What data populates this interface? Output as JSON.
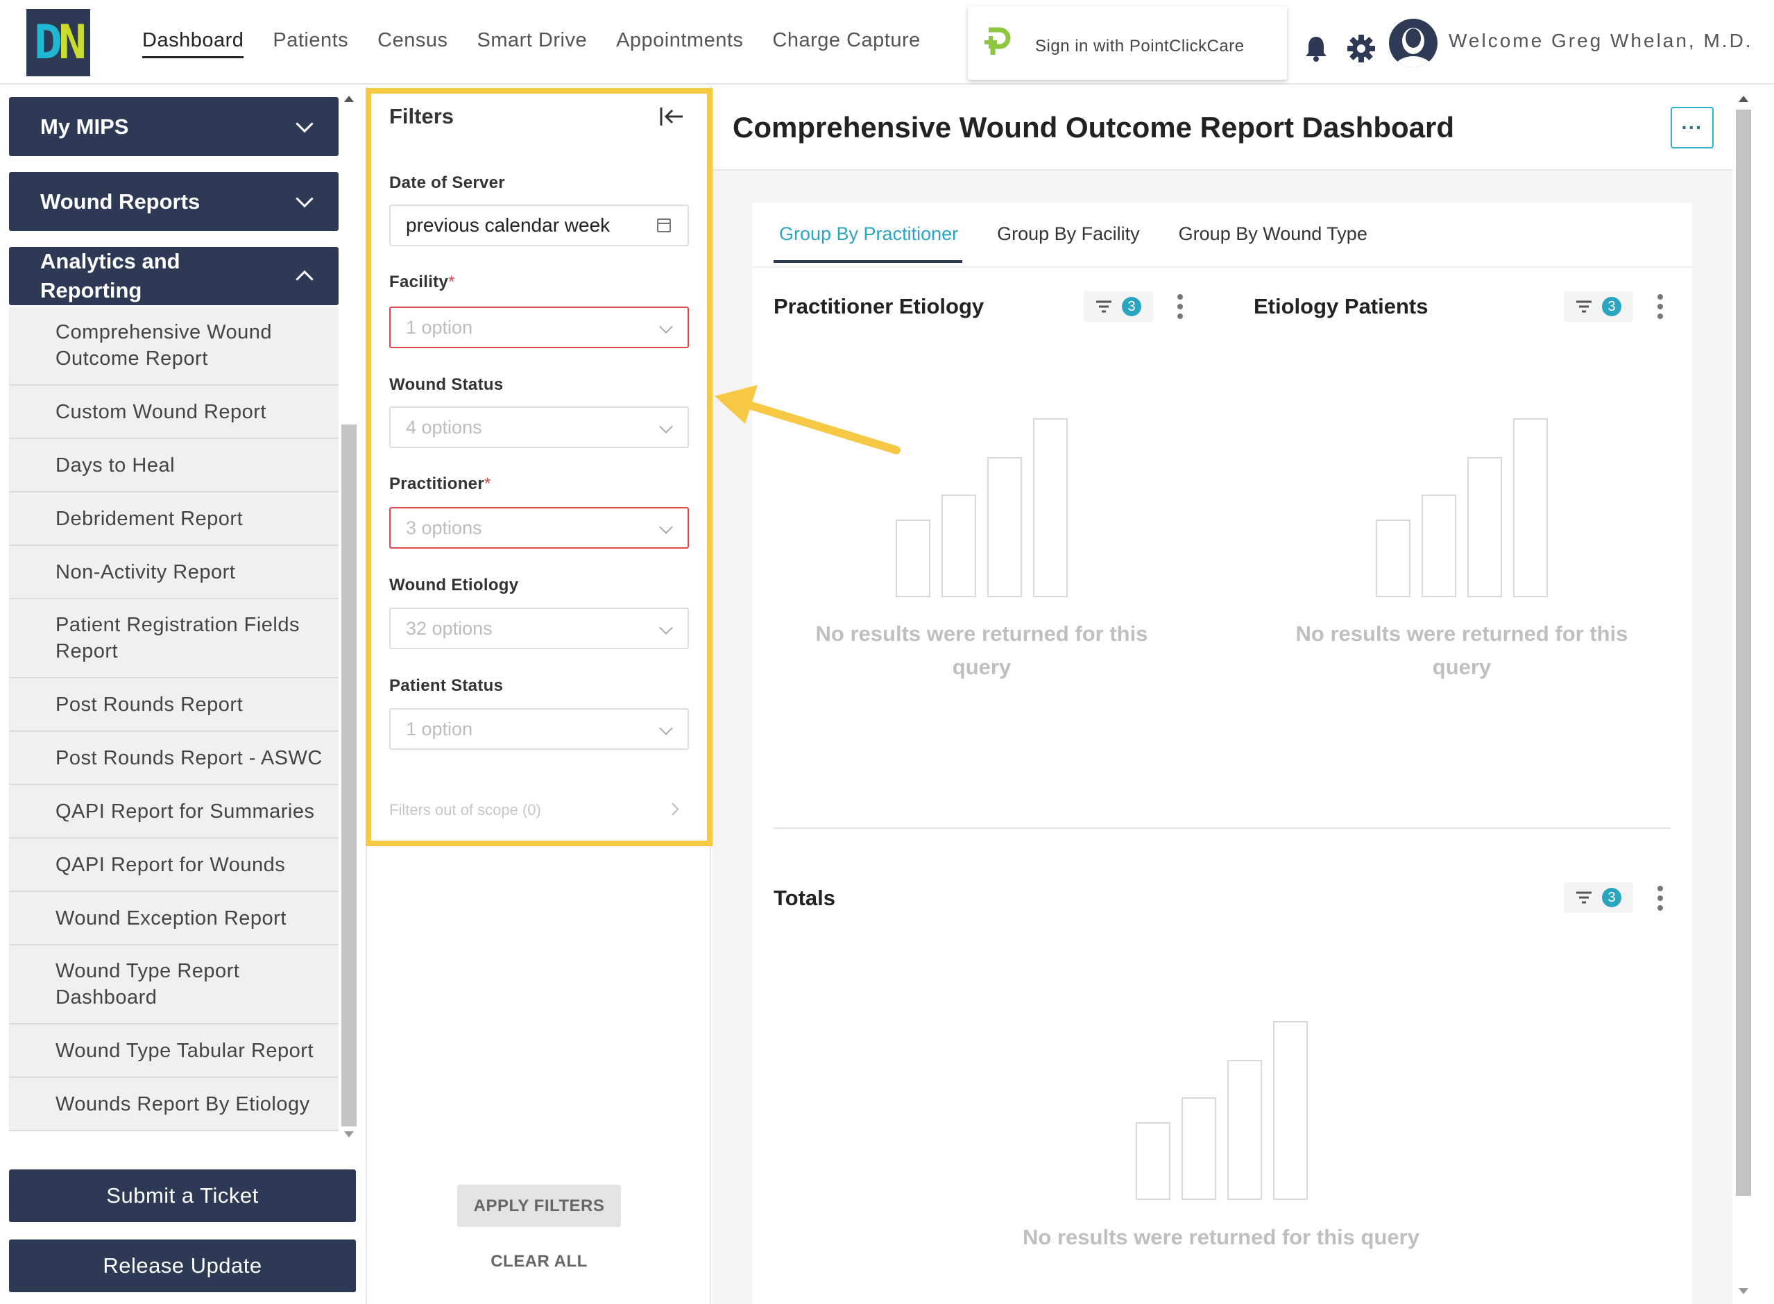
{
  "brand": {
    "logo_d": "D",
    "logo_n": "N"
  },
  "nav": {
    "items": [
      "Dashboard",
      "Patients",
      "Census",
      "Smart Drive",
      "Appointments",
      "Charge Capture"
    ],
    "active": "Dashboard"
  },
  "pcc": {
    "label": "Sign in with PointClickCare"
  },
  "user": {
    "welcome": "Welcome Greg Whelan, M.D."
  },
  "sidebar": {
    "sections": [
      {
        "label": "My MIPS",
        "expanded": false
      },
      {
        "label": "Wound Reports",
        "expanded": false
      },
      {
        "label": "Analytics and Reporting",
        "expanded": true
      }
    ],
    "analytics_items": [
      "Comprehensive Wound Outcome Report",
      "Custom Wound Report",
      "Days to Heal",
      "Debridement Report",
      "Non-Activity Report",
      "Patient Registration Fields Report",
      "Post Rounds Report",
      "Post Rounds Report - ASWC",
      "QAPI Report for Summaries",
      "QAPI Report for Wounds",
      "Wound Exception Report",
      "Wound Type Report Dashboard",
      "Wound Type Tabular Report",
      "Wounds Report By Etiology"
    ],
    "submit_ticket": "Submit a Ticket",
    "release_update": "Release Update"
  },
  "filters": {
    "title": "Filters",
    "date": {
      "label": "Date of Server",
      "value": "previous calendar week"
    },
    "facility": {
      "label": "Facility",
      "required": "*",
      "placeholder": "1 option"
    },
    "wound_status": {
      "label": "Wound Status",
      "placeholder": "4 options"
    },
    "practitioner": {
      "label": "Practitioner",
      "required": "*",
      "placeholder": "3 options"
    },
    "wound_etiology": {
      "label": "Wound Etiology",
      "placeholder": "32 options"
    },
    "patient_status": {
      "label": "Patient Status",
      "placeholder": "1 option"
    },
    "out_of_scope": "Filters out of scope (0)",
    "apply": "APPLY FILTERS",
    "clear": "CLEAR ALL"
  },
  "dashboard": {
    "title": "Comprehensive Wound Outcome Report Dashboard",
    "more": "···",
    "tabs": [
      "Group By Practitioner",
      "Group By Facility",
      "Group By Wound Type"
    ],
    "active_tab": "Group By Practitioner",
    "charts": [
      {
        "title": "Practitioner Etiology",
        "filter_count": "3",
        "empty": "No results were returned for this query"
      },
      {
        "title": "Etiology Patients",
        "filter_count": "3",
        "empty": "No results were returned for this query"
      },
      {
        "title": "Totals",
        "filter_count": "3",
        "empty": "No results were returned for this query"
      }
    ]
  },
  "colors": {
    "navy": "#2e3a55",
    "accent": "#2aa5c0",
    "highlight": "#f7c843",
    "required": "#e0474c"
  }
}
